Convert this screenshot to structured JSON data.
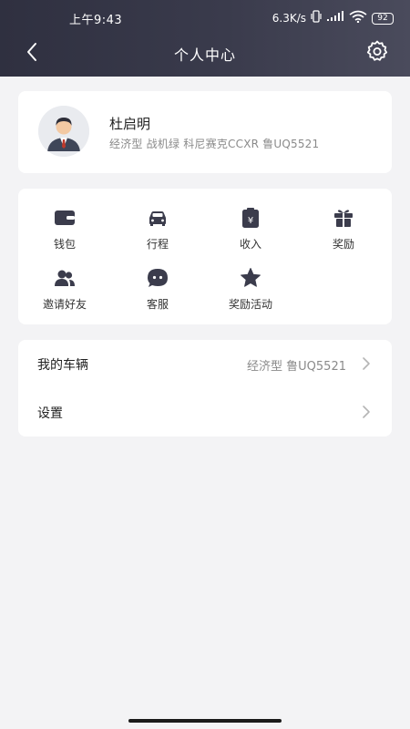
{
  "status_bar": {
    "time": "上午9:43",
    "network_speed": "6.3K/s",
    "battery": "92"
  },
  "header": {
    "title": "个人中心",
    "back_icon": "chevron-left-icon",
    "settings_icon": "gear-icon"
  },
  "profile": {
    "name": "杜启明",
    "description": "经济型 战机绿 科尼赛克CCXR 鲁UQ5521",
    "avatar_icon": "user-avatar-icon"
  },
  "grid": {
    "items": [
      {
        "label": "钱包",
        "icon": "wallet-icon"
      },
      {
        "label": "行程",
        "icon": "car-icon"
      },
      {
        "label": "收入",
        "icon": "income-icon"
      },
      {
        "label": "奖励",
        "icon": "gift-icon"
      },
      {
        "label": "邀请好友",
        "icon": "invite-friends-icon"
      },
      {
        "label": "客服",
        "icon": "customer-service-icon"
      },
      {
        "label": "奖励活动",
        "icon": "star-icon"
      }
    ]
  },
  "list": {
    "my_vehicle": {
      "label": "我的车辆",
      "value": "经济型 鲁UQ5521"
    },
    "settings": {
      "label": "设置"
    }
  },
  "colors": {
    "header_bg": "#353646",
    "page_bg": "#f3f3f5",
    "icon_color": "#3b3c4c",
    "secondary_text": "#8a8a8a"
  }
}
